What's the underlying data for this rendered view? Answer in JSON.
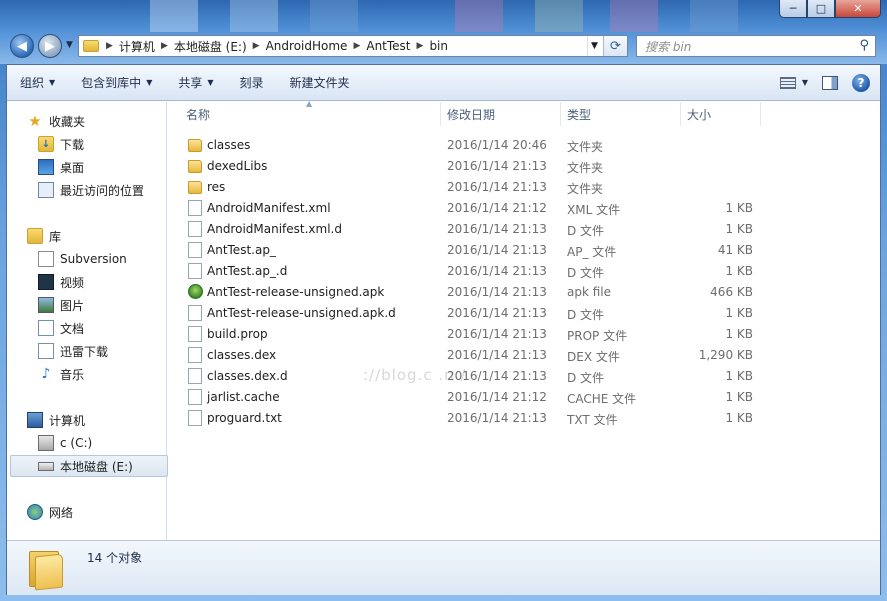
{
  "window": {
    "minimize": "─",
    "maximize": "□",
    "close": "✕"
  },
  "address": {
    "crumbs": [
      "计算机",
      "本地磁盘 (E:)",
      "AndroidHome",
      "AntTest",
      "bin"
    ]
  },
  "search": {
    "placeholder": "搜索 bin"
  },
  "toolbar": {
    "organize": "组织",
    "include_in_library": "包含到库中",
    "share": "共享",
    "burn": "刻录",
    "new_folder": "新建文件夹"
  },
  "sidebar": {
    "favorites": "收藏夹",
    "downloads": "下载",
    "desktop": "桌面",
    "recent": "最近访问的位置",
    "libraries": "库",
    "subversion": "Subversion",
    "videos": "视频",
    "pictures": "图片",
    "documents": "文档",
    "thunder": "迅雷下载",
    "music": "音乐",
    "computer": "计算机",
    "drive_c": "c (C:)",
    "drive_e": "本地磁盘 (E:)",
    "network": "网络"
  },
  "columns": {
    "name": "名称",
    "modified": "修改日期",
    "type": "类型",
    "size": "大小"
  },
  "files": [
    {
      "name": "classes",
      "date": "2016/1/14 20:46",
      "type": "文件夹",
      "size": "",
      "kind": "folder"
    },
    {
      "name": "dexedLibs",
      "date": "2016/1/14 21:13",
      "type": "文件夹",
      "size": "",
      "kind": "folder"
    },
    {
      "name": "res",
      "date": "2016/1/14 21:13",
      "type": "文件夹",
      "size": "",
      "kind": "folder"
    },
    {
      "name": "AndroidManifest.xml",
      "date": "2016/1/14 21:12",
      "type": "XML 文件",
      "size": "1 KB",
      "kind": "doc"
    },
    {
      "name": "AndroidManifest.xml.d",
      "date": "2016/1/14 21:13",
      "type": "D 文件",
      "size": "1 KB",
      "kind": "doc"
    },
    {
      "name": "AntTest.ap_",
      "date": "2016/1/14 21:13",
      "type": "AP_ 文件",
      "size": "41 KB",
      "kind": "doc"
    },
    {
      "name": "AntTest.ap_.d",
      "date": "2016/1/14 21:13",
      "type": "D 文件",
      "size": "1 KB",
      "kind": "doc"
    },
    {
      "name": "AntTest-release-unsigned.apk",
      "date": "2016/1/14 21:13",
      "type": "apk file",
      "size": "466 KB",
      "kind": "apk"
    },
    {
      "name": "AntTest-release-unsigned.apk.d",
      "date": "2016/1/14 21:13",
      "type": "D 文件",
      "size": "1 KB",
      "kind": "doc"
    },
    {
      "name": "build.prop",
      "date": "2016/1/14 21:13",
      "type": "PROP 文件",
      "size": "1 KB",
      "kind": "doc"
    },
    {
      "name": "classes.dex",
      "date": "2016/1/14 21:13",
      "type": "DEX 文件",
      "size": "1,290 KB",
      "kind": "doc"
    },
    {
      "name": "classes.dex.d",
      "date": "2016/1/14 21:13",
      "type": "D 文件",
      "size": "1 KB",
      "kind": "doc"
    },
    {
      "name": "jarlist.cache",
      "date": "2016/1/14 21:12",
      "type": "CACHE 文件",
      "size": "1 KB",
      "kind": "doc"
    },
    {
      "name": "proguard.txt",
      "date": "2016/1/14 21:13",
      "type": "TXT 文件",
      "size": "1 KB",
      "kind": "doc"
    }
  ],
  "watermark": "://blog.c  .n  /",
  "status": {
    "count": "14 个对象"
  }
}
